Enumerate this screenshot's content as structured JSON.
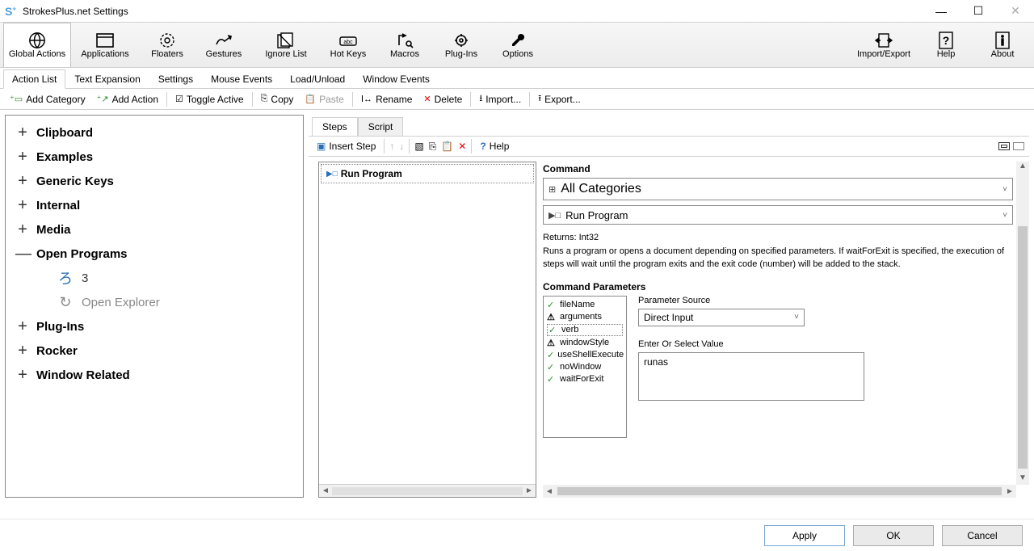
{
  "window": {
    "title": "StrokesPlus.net Settings"
  },
  "main_toolbar": [
    {
      "label": "Global Actions",
      "icon": "globe",
      "active": true
    },
    {
      "label": "Applications",
      "icon": "window"
    },
    {
      "label": "Floaters",
      "icon": "floater"
    },
    {
      "label": "Gestures",
      "icon": "gesture"
    },
    {
      "label": "Ignore List",
      "icon": "ignore"
    },
    {
      "label": "Hot Keys",
      "icon": "hotkey"
    },
    {
      "label": "Macros",
      "icon": "macro"
    },
    {
      "label": "Plug-Ins",
      "icon": "plug"
    },
    {
      "label": "Options",
      "icon": "wrench"
    }
  ],
  "main_toolbar_right": [
    {
      "label": "Import/Export",
      "icon": "impexp"
    },
    {
      "label": "Help",
      "icon": "help"
    },
    {
      "label": "About",
      "icon": "about"
    }
  ],
  "subtabs": [
    "Action List",
    "Text Expansion",
    "Settings",
    "Mouse Events",
    "Load/Unload",
    "Window Events"
  ],
  "active_subtab": 0,
  "action_toolbar": [
    {
      "label": "Add Category",
      "icon": "addcat"
    },
    {
      "label": "Add Action",
      "icon": "addact"
    },
    {
      "sep": true
    },
    {
      "label": "Toggle Active",
      "icon": "toggle"
    },
    {
      "sep": true
    },
    {
      "label": "Copy",
      "icon": "copy"
    },
    {
      "label": "Paste",
      "icon": "paste",
      "disabled": true
    },
    {
      "sep": true
    },
    {
      "label": "Rename",
      "icon": "rename"
    },
    {
      "label": "Delete",
      "icon": "delete"
    },
    {
      "sep": true
    },
    {
      "label": "Import...",
      "icon": "import"
    },
    {
      "sep": true
    },
    {
      "label": "Export...",
      "icon": "export"
    }
  ],
  "tree": [
    {
      "label": "Clipboard",
      "expanded": false
    },
    {
      "label": "Examples",
      "expanded": false
    },
    {
      "label": "Generic Keys",
      "expanded": false
    },
    {
      "label": "Internal",
      "expanded": false
    },
    {
      "label": "Media",
      "expanded": false
    },
    {
      "label": "Open Programs",
      "expanded": true,
      "children": [
        {
          "label": "3",
          "icon": "gesture",
          "dim": false
        },
        {
          "label": "Open Explorer",
          "icon": "explorer",
          "dim": true
        }
      ]
    },
    {
      "label": "Plug-Ins",
      "expanded": false
    },
    {
      "label": "Rocker",
      "expanded": false
    },
    {
      "label": "Window Related",
      "expanded": false
    }
  ],
  "steps": {
    "tabs": [
      "Steps",
      "Script"
    ],
    "active_tab": 0,
    "toolbar": {
      "insert": "Insert Step",
      "help": "Help"
    },
    "list": [
      {
        "label": "Run Program"
      }
    ]
  },
  "detail": {
    "command_label": "Command",
    "category_value": "All Categories",
    "command_value": "Run Program",
    "returns": "Returns: Int32",
    "description": "Runs a program or opens a document depending on specified parameters. If waitForExit is specified, the execution of steps will wait until the program exits and the exit code (number) will be added to the stack.",
    "params_label": "Command Parameters",
    "params": [
      {
        "name": "fileName",
        "status": "ok"
      },
      {
        "name": "arguments",
        "status": "warn"
      },
      {
        "name": "verb",
        "status": "ok",
        "selected": true
      },
      {
        "name": "windowStyle",
        "status": "warn"
      },
      {
        "name": "useShellExecute",
        "status": "ok"
      },
      {
        "name": "noWindow",
        "status": "ok"
      },
      {
        "name": "waitForExit",
        "status": "ok"
      }
    ],
    "param_source_label": "Parameter Source",
    "param_source_value": "Direct Input",
    "value_label": "Enter Or Select Value",
    "value": "runas"
  },
  "footer": {
    "apply": "Apply",
    "ok": "OK",
    "cancel": "Cancel"
  }
}
